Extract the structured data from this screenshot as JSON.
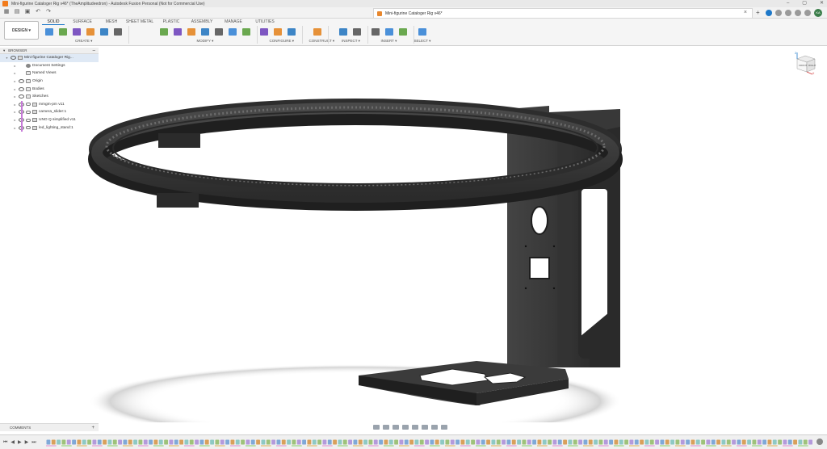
{
  "window": {
    "title": "Mini-figurine Cataloger Rig v46* (TheAmplitudeedron) - Autodesk Fusion Personal (Not for Commercial Use)",
    "controls": [
      "–",
      "▢",
      "✕"
    ]
  },
  "document_tab": {
    "title": "Mini-figurine Cataloger Rig v46*",
    "close": "×"
  },
  "user": {
    "initials": "KA"
  },
  "workspace": {
    "label": "DESIGN ▾"
  },
  "ribbon": {
    "tabs": [
      "SOLID",
      "SURFACE",
      "MESH",
      "SHEET METAL",
      "PLASTIC",
      "ASSEMBLY",
      "MANAGE",
      "UTILITIES"
    ],
    "active_tab": "SOLID",
    "groups": [
      {
        "label": "CREATE ▾",
        "tools": 6
      },
      {
        "label": "MODIFY ▾",
        "tools": 7
      },
      {
        "label": "CONFIGURE ▾",
        "tools": 3
      },
      {
        "label": "CONSTRUCT ▾",
        "tools": 1
      },
      {
        "label": "INSPECT ▾",
        "tools": 2
      },
      {
        "label": "INSERT ▾",
        "tools": 3
      },
      {
        "label": "SELECT ▾",
        "tools": 1
      }
    ]
  },
  "browser": {
    "title": "BROWSER",
    "items": [
      {
        "label": "Mini-figurine Cataloger Rig...",
        "icon": "document-icon",
        "level": 0,
        "root": true
      },
      {
        "label": "Document Settings",
        "icon": "gear-icon",
        "level": 1
      },
      {
        "label": "Named Views",
        "icon": "folder-icon",
        "level": 1
      },
      {
        "label": "Origin",
        "icon": "folder-icon",
        "level": 1
      },
      {
        "label": "Bodies",
        "icon": "folder-icon",
        "level": 1
      },
      {
        "label": "Sketches",
        "icon": "folder-icon",
        "level": 1
      },
      {
        "label": "mmgm-pm v11",
        "icon": "component-icon",
        "level": 1,
        "marker": "#c77ad8"
      },
      {
        "label": "camera_slider:1",
        "icon": "component-icon",
        "level": 1,
        "marker": "#c77ad8"
      },
      {
        "label": "UNO Q simplified v11",
        "icon": "component-icon",
        "level": 1,
        "marker": "#c77ad8"
      },
      {
        "label": "led_lighting_stand:1",
        "icon": "component-icon",
        "level": 1,
        "marker": "#c77ad8"
      }
    ]
  },
  "viewcube": {
    "front": "FRONT",
    "right": "RIGHT",
    "axis_z": "Z",
    "axis_x": "X"
  },
  "comments": {
    "title": "COMMENTS",
    "add": "+"
  },
  "timeline": {
    "controls": [
      "⏮",
      "◀",
      "▶",
      "▶",
      "⏭"
    ],
    "item_count": 150
  },
  "colors": {
    "accent": "#1d78c9",
    "model": "#3a3a3a",
    "model_edge": "#1c1c1c"
  }
}
